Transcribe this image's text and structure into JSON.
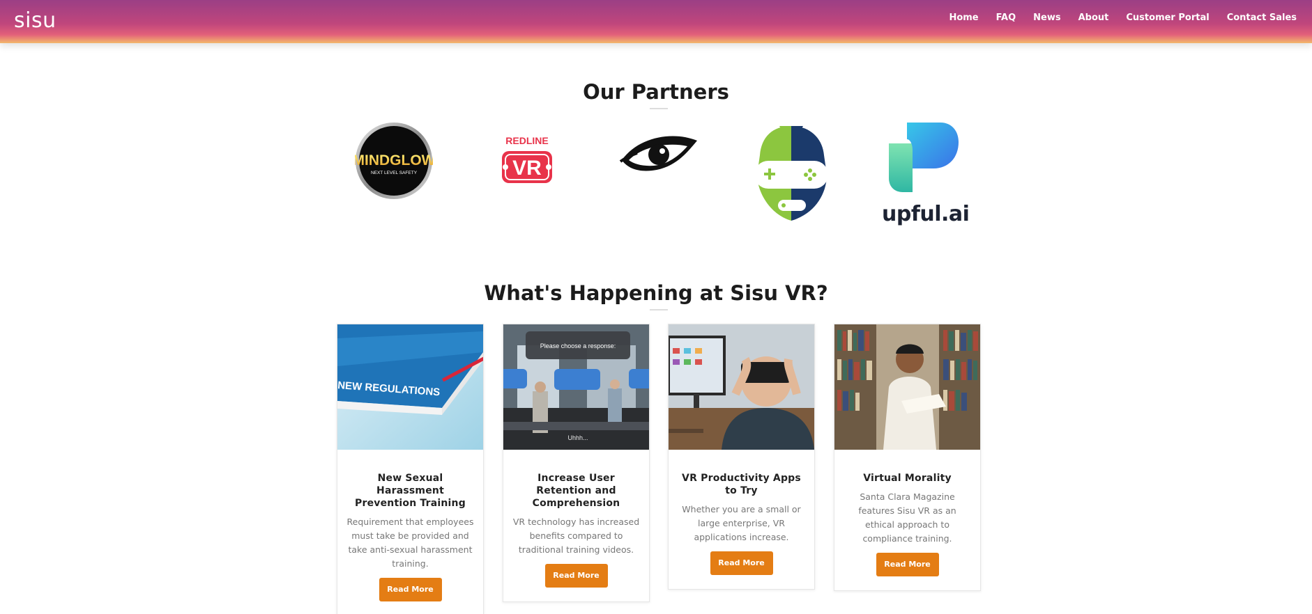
{
  "header": {
    "logo": "sisu",
    "nav": [
      "Home",
      "FAQ",
      "News",
      "About",
      "Customer Portal",
      "Contact Sales"
    ]
  },
  "partners": {
    "title": "Our Partners",
    "logos": [
      {
        "name": "mindglow-logo",
        "text": "MINDGLOW",
        "subtext": "NEXT LEVEL SAFETY"
      },
      {
        "name": "redline-vr-logo",
        "text": "REDLINE",
        "subtext": "VR"
      },
      {
        "name": "eye-logo"
      },
      {
        "name": "gamer-head-logo"
      },
      {
        "name": "upful-logo",
        "text": "upful.ai"
      }
    ]
  },
  "news": {
    "title": "What's Happening at Sisu VR?",
    "cards": [
      {
        "image_text": "NEW REGULATIONS",
        "title": "New Sexual Harassment Prevention Training",
        "text": "Requirement that employees must take be provided and take anti-sexual harassment training.",
        "button": "Read More"
      },
      {
        "image_text": "Please choose a response:",
        "image_caption": "Uhhh...",
        "title": "Increase User Retention and Comprehension",
        "text": "VR technology has increased benefits compared to traditional training videos.",
        "button": "Read More"
      },
      {
        "title": "VR Productivity Apps to Try",
        "text": "Whether you are a small or large enterprise, VR applications increase.",
        "button": "Read More"
      },
      {
        "title": "Virtual Morality",
        "text": "Santa Clara Magazine features Sisu VR as an ethical approach to compliance training.",
        "button": "Read More"
      }
    ]
  }
}
